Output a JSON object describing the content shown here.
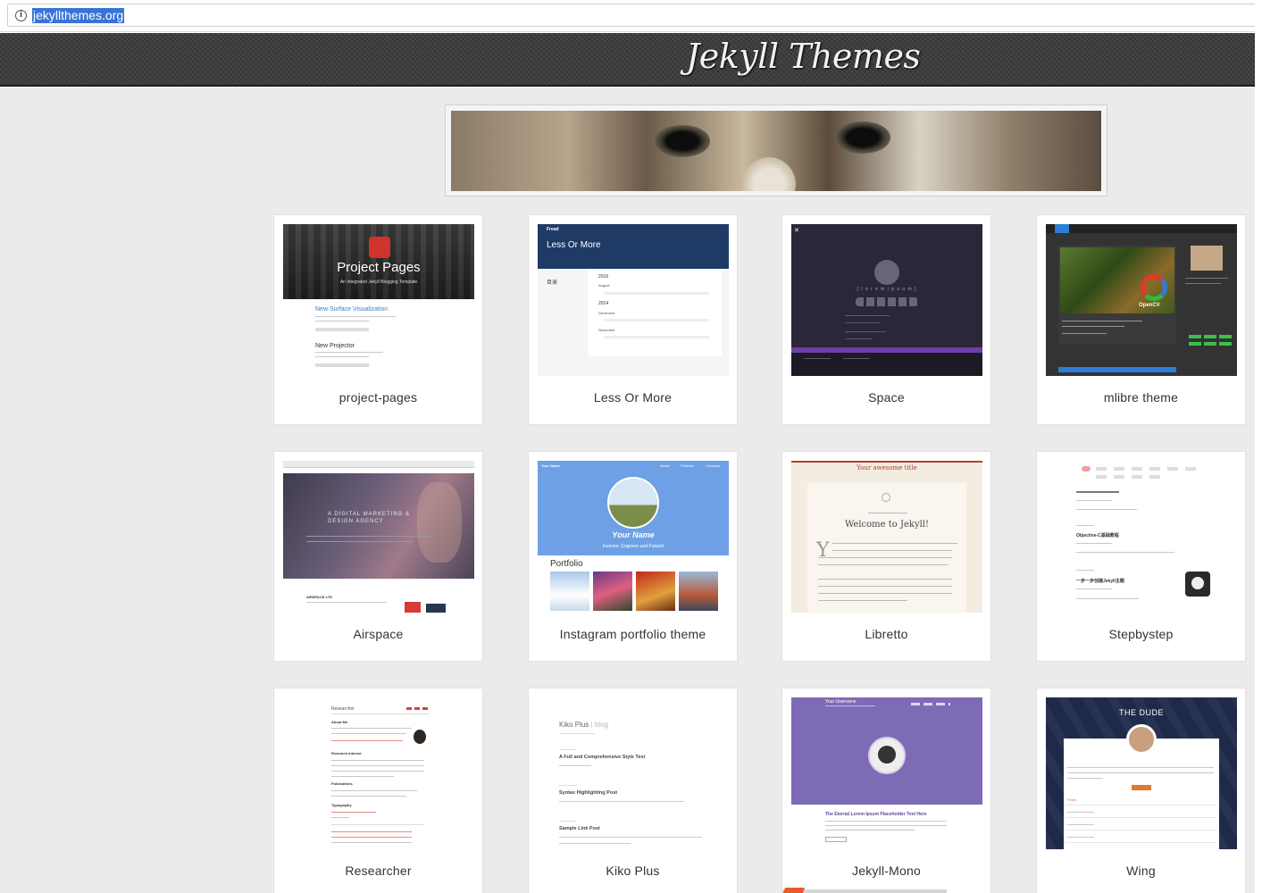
{
  "browser": {
    "url": "jekyllthemes.org"
  },
  "site": {
    "title": "Jekyll Themes"
  },
  "themes": [
    {
      "name": "project-pages",
      "thumb_title": "Project Pages",
      "thumb_sub": "An Integrated Jekyll Blogging Template",
      "post1": "New Surface Visualization",
      "post2": "New Projector"
    },
    {
      "name": "Less Or More",
      "thumb_title": "Less Or More",
      "brand": "Fread",
      "section": "目录",
      "year1": "2016",
      "month1": "August",
      "year2": "2014",
      "month2": "December",
      "month3": "November"
    },
    {
      "name": "Space",
      "thumb_title": "[ l o r e m   i p s u m ]"
    },
    {
      "name": "mlibre theme",
      "badge": "OpenCV"
    },
    {
      "name": "Airspace",
      "hero": "A DIGITAL MARKETING & DESIGN AGENCY",
      "foot": "AIRSPACE LTD"
    },
    {
      "name": "Instagram portfolio theme",
      "brand": "Your Name",
      "hero_name": "Your Name",
      "hero_sub": "Inventor, Engineer and Futurist",
      "section": "Portfolio",
      "nav1": "About",
      "nav2": "Portfolio",
      "nav3": "Contacts"
    },
    {
      "name": "Libretto",
      "thumb_title": "Your awesome title",
      "post_title": "Welcome to Jekyll!"
    },
    {
      "name": "Stepbystep",
      "post1": "Objective-C基础教程",
      "post2": "一步一步创建Jekyll主题"
    },
    {
      "name": "Researcher",
      "brand": "Researcher",
      "h1": "About Me",
      "h2": "Research Interest",
      "h3": "Publications",
      "h4": "Typography"
    },
    {
      "name": "Kiko Plus",
      "brand": "Kiko Plus",
      "brand_suffix": "| blog",
      "post1": "A Full and Comprehensive Style Test",
      "post2": "Syntax Highlighting Post",
      "post3": "Sample Link Post"
    },
    {
      "name": "Jekyll-Mono",
      "brand": "Your Username",
      "post1": "The Eternal Lorem Ipsum Placeholder Text Here"
    },
    {
      "name": "Wing",
      "hero": "THE DUDE",
      "section": "Posts"
    }
  ]
}
